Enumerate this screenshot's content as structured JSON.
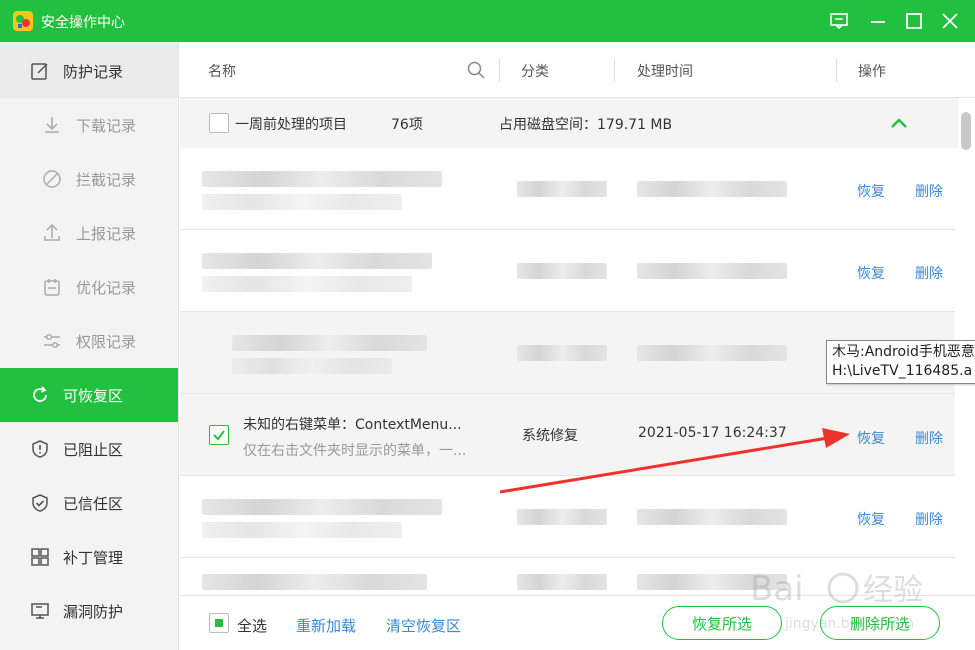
{
  "app": {
    "title": "安全操作中心",
    "accent_color": "#21c13f",
    "window_controls": [
      "feedback-icon",
      "minimize-icon",
      "maximize-icon",
      "close-icon"
    ]
  },
  "sidebar": {
    "items": [
      {
        "label": "防护记录",
        "icon": "edit-icon"
      },
      {
        "label": "下载记录",
        "icon": "download-icon"
      },
      {
        "label": "拦截记录",
        "icon": "block-icon"
      },
      {
        "label": "上报记录",
        "icon": "upload-icon"
      },
      {
        "label": "优化记录",
        "icon": "calendar-icon"
      },
      {
        "label": "权限记录",
        "icon": "permission-icon"
      },
      {
        "label": "可恢复区",
        "icon": "refresh-icon"
      },
      {
        "label": "已阻止区",
        "icon": "shield-alert-icon"
      },
      {
        "label": "已信任区",
        "icon": "shield-check-icon"
      },
      {
        "label": "补丁管理",
        "icon": "grid-icon"
      },
      {
        "label": "漏洞防护",
        "icon": "monitor-icon"
      }
    ]
  },
  "table": {
    "headers": {
      "name": "名称",
      "category": "分类",
      "time": "处理时间",
      "action": "操作"
    },
    "group": {
      "label": "一周前处理的项目",
      "count": "76项",
      "disk_usage": "占用磁盘空间：179.71 MB"
    },
    "selected_row": {
      "title": "未知的右键菜单：ContextMenu...",
      "subtitle": "仅在右击文件夹时显示的菜单，一...",
      "category": "系统修复",
      "time": "2021-05-17 16:24:37"
    },
    "restore_label": "恢复",
    "delete_label": "删除"
  },
  "tooltip": {
    "line1": "木马:Android手机恶意",
    "line2": "H:\\LiveTV_116485.a"
  },
  "footer": {
    "select_all": "全选",
    "reload": "重新加载",
    "clear": "清空恢复区",
    "restore_selected": "恢复所选",
    "delete_selected": "删除所选"
  }
}
